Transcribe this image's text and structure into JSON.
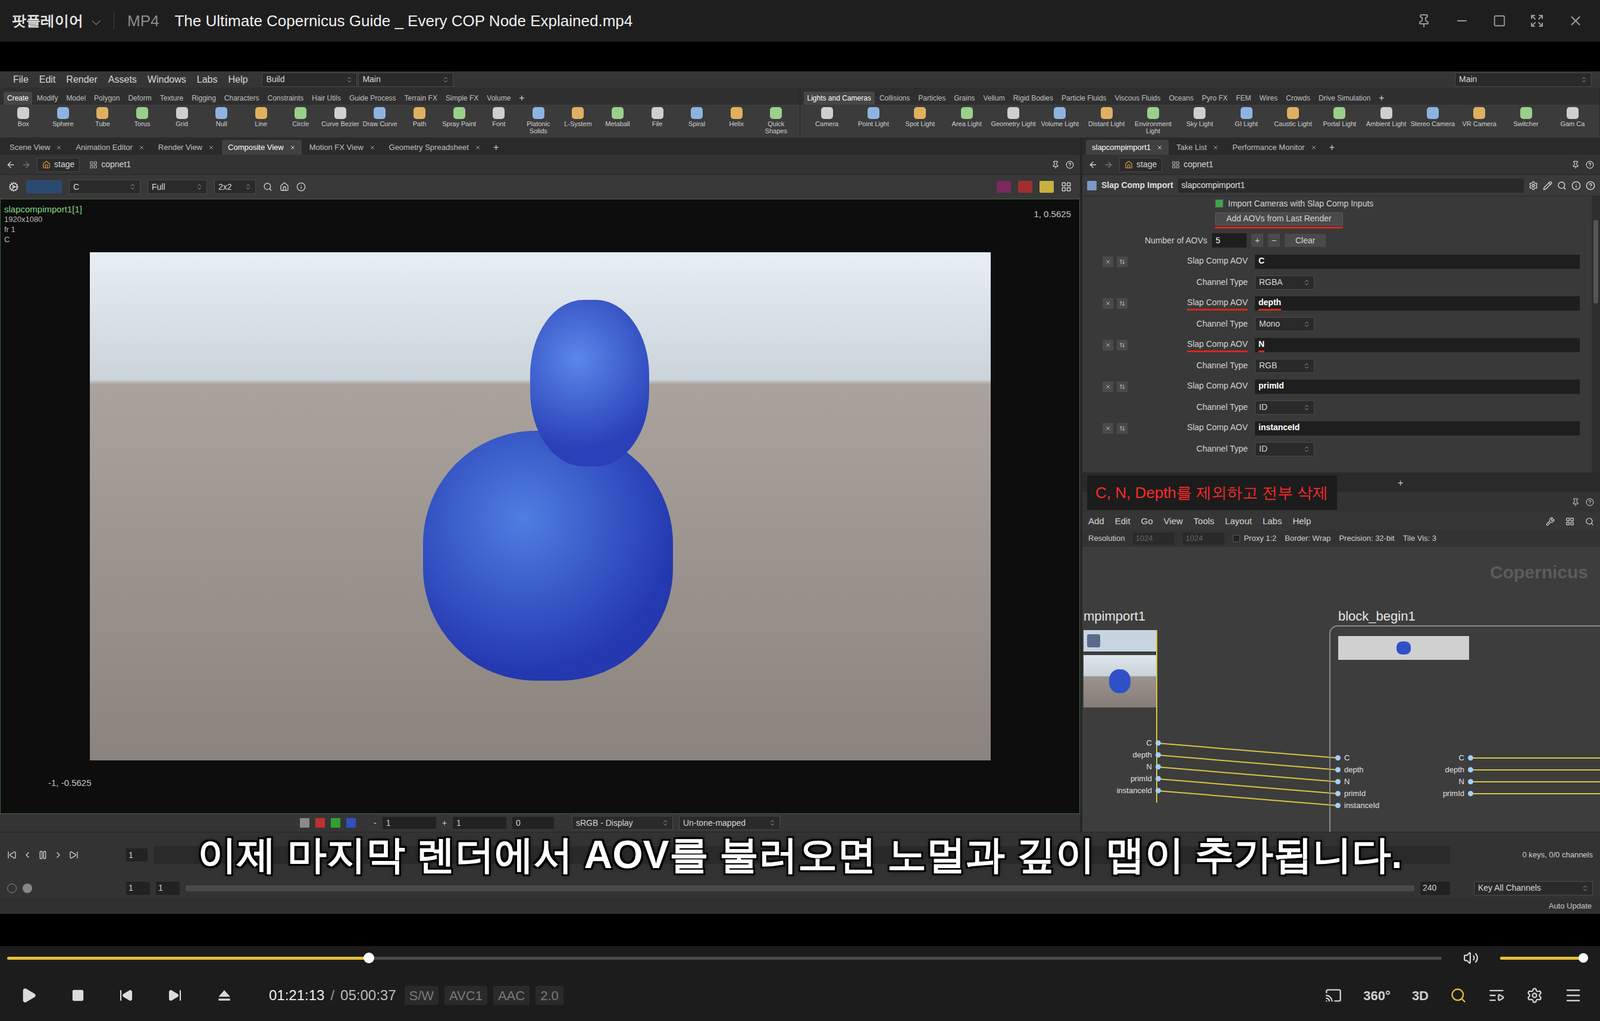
{
  "player": {
    "app_name": "팟플레이어",
    "app_menu_glyph": "⌵",
    "format": "MP4",
    "title": "The Ultimate Copernicus Guide _ Every COP Node Explained.mp4",
    "seek": {
      "level": 0.252
    },
    "volume": {
      "level": 1.0
    },
    "time": "01:21:13",
    "time_separator": "/",
    "duration": "05:00:37",
    "badges": [
      "S/W",
      "AVC1",
      "AAC",
      "2.0"
    ],
    "right_labels": [
      "360°",
      "3D"
    ]
  },
  "subtitle": "이제 마지막 렌더에서 AOV를 불러오면 노멀과 깊이 맵이 추가됩니다.",
  "houdini": {
    "menu": [
      "File",
      "Edit",
      "Render",
      "Assets",
      "Windows",
      "Labs",
      "Help"
    ],
    "desktop": "Build",
    "context": "Main",
    "right_desktop": "Main",
    "shelf_left": {
      "tabs": [
        {
          "label": "Create",
          "selected": true
        },
        {
          "label": "Modify",
          "selected": false
        },
        {
          "label": "Model",
          "selected": false
        },
        {
          "label": "Polygon",
          "selected": false
        },
        {
          "label": "Deform",
          "selected": false
        },
        {
          "label": "Texture",
          "selected": false
        },
        {
          "label": "Rigging",
          "selected": false
        },
        {
          "label": "Characters",
          "selected": false
        },
        {
          "label": "Constraints",
          "selected": false
        },
        {
          "label": "Hair Utils",
          "selected": false
        },
        {
          "label": "Guide Process",
          "selected": false
        },
        {
          "label": "Terrain FX",
          "selected": false
        },
        {
          "label": "Simple FX",
          "selected": false
        },
        {
          "label": "Volume",
          "selected": false
        }
      ],
      "add": "+",
      "tools": [
        "Box",
        "Sphere",
        "Tube",
        "Torus",
        "Grid",
        "Null",
        "Line",
        "Circle",
        "Curve Bezier",
        "Draw Curve",
        "Path",
        "Spray Paint",
        "Font",
        "Platonic Solids",
        "L-System",
        "Metaball",
        "File",
        "Spiral",
        "Helix",
        "Quick Shapes"
      ]
    },
    "shelf_right": {
      "tabs": [
        {
          "label": "Lights and Cameras",
          "selected": true
        },
        {
          "label": "Collisions",
          "selected": false
        },
        {
          "label": "Particles",
          "selected": false
        },
        {
          "label": "Grains",
          "selected": false
        },
        {
          "label": "Vellum",
          "selected": false
        },
        {
          "label": "Rigid Bodies",
          "selected": false
        },
        {
          "label": "Particle Fluids",
          "selected": false
        },
        {
          "label": "Viscous Fluids",
          "selected": false
        },
        {
          "label": "Oceans",
          "selected": false
        },
        {
          "label": "Pyro FX",
          "selected": false
        },
        {
          "label": "FEM",
          "selected": false
        },
        {
          "label": "Wires",
          "selected": false
        },
        {
          "label": "Crowds",
          "selected": false
        },
        {
          "label": "Drive Simulation",
          "selected": false
        }
      ],
      "add": "+",
      "tools": [
        "Camera",
        "Point Light",
        "Spot Light",
        "Area Light",
        "Geometry Light",
        "Volume Light",
        "Distant Light",
        "Environment Light",
        "Sky Light",
        "GI Light",
        "Caustic Light",
        "Portal Light",
        "Ambient Light",
        "Stereo Camera",
        "VR Camera",
        "Switcher",
        "Gam Ca"
      ]
    },
    "viewer": {
      "tabs": [
        {
          "label": "Scene View",
          "selected": false
        },
        {
          "label": "Animation Editor",
          "selected": false
        },
        {
          "label": "Render View",
          "selected": false
        },
        {
          "label": "Composite View",
          "selected": true
        },
        {
          "label": "Motion FX View",
          "selected": false
        },
        {
          "label": "Geometry Spreadsheet",
          "selected": false
        }
      ],
      "add": "+",
      "path": [
        "stage",
        "copnet1"
      ],
      "toolbar": {
        "plane": "C",
        "quality": "Full",
        "layout": "2x2"
      },
      "overlay": {
        "node": "slapcompimport1[1]",
        "resolution": "1920x1080",
        "frame": "fr 1",
        "plane": "C",
        "top_right": "1, 0.5625",
        "bottom_left": "-1, -0.5625"
      },
      "bottom": {
        "minus": "-",
        "exposure": "1",
        "plus": "+",
        "gamma": "1",
        "offset": "0",
        "display": "sRGB - Display",
        "tonemap": "Un-tone-mapped"
      }
    },
    "params": {
      "tabs": [
        {
          "label": "slapcompimport1",
          "selected": true
        },
        {
          "label": "Take List",
          "selected": false
        },
        {
          "label": "Performance Monitor",
          "selected": false
        }
      ],
      "add": "+",
      "path": [
        "stage",
        "copnet1"
      ],
      "node_type": "Slap Comp Import",
      "node_name": "slapcompimport1",
      "import_cameras": {
        "label": "Import Cameras with Slap Comp Inputs",
        "checked": true
      },
      "add_aovs": {
        "label": "Add AOVs from Last Render",
        "annotated": true
      },
      "count": {
        "label": "Number of AOVs",
        "value": "5",
        "plus": "+",
        "minus": "−",
        "clear": "Clear"
      },
      "aovs": [
        {
          "label": "Slap Comp AOV",
          "value": "C",
          "type_label": "Channel Type",
          "type": "RGBA",
          "annotated": false
        },
        {
          "label": "Slap Comp AOV",
          "value": "depth",
          "type_label": "Channel Type",
          "type": "Mono",
          "annotated": true
        },
        {
          "label": "Slap Comp AOV",
          "value": "N",
          "type_label": "Channel Type",
          "type": "RGB",
          "annotated": true
        },
        {
          "label": "Slap Comp AOV",
          "value": "primId",
          "type_label": "Channel Type",
          "type": "ID",
          "annotated": false
        },
        {
          "label": "Slap Comp AOV",
          "value": "instanceId",
          "type_label": "Channel Type",
          "type": "ID",
          "annotated": false
        }
      ]
    },
    "network": {
      "annotation": "C, N, Depth를 제외하고 전부 삭제",
      "add": "+",
      "menu": [
        "Add",
        "Edit",
        "Go",
        "View",
        "Tools",
        "Layout",
        "Labs",
        "Help"
      ],
      "resolution": {
        "label": "Resolution",
        "width": "1024",
        "height": "1024",
        "proxy": "Proxy 1:2",
        "proxy_checked": false,
        "border": "Border: Wrap",
        "precision": "Precision: 32-bit",
        "tile_vis": "Tile Vis: 3"
      },
      "watermark": "Copernicus",
      "source_node": {
        "name": "mpimport1",
        "outputs": [
          "C",
          "depth",
          "N",
          "primId",
          "instanceId"
        ]
      },
      "block_node": {
        "name": "block_begin1",
        "inputs": [
          "C",
          "depth",
          "N",
          "primId",
          "instanceId"
        ],
        "outputs": [
          "C",
          "depth",
          "N",
          "primId"
        ]
      }
    },
    "timeline": {
      "frame": "1",
      "range_start": "1",
      "range_start_2": "1",
      "range_end": "240",
      "keys": "0 keys, 0/0 channels",
      "key_mode": "Key All Channels",
      "auto_update": "Auto Update"
    }
  }
}
